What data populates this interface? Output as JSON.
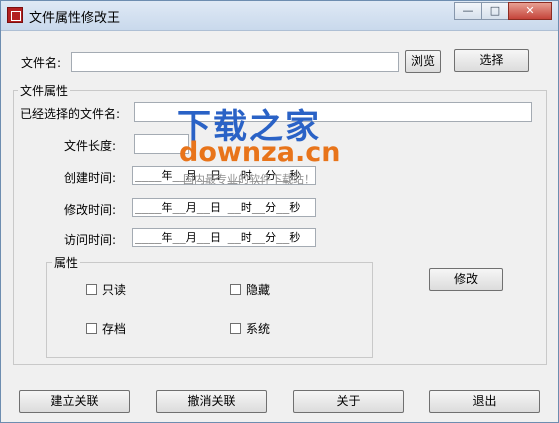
{
  "window": {
    "title": "文件属性修改王",
    "minimize": "—",
    "maximize": "□",
    "close": "✕"
  },
  "file": {
    "label": "文件名:",
    "value": "",
    "browse_label": "浏览",
    "select_label": "选择"
  },
  "attributes_group": {
    "title": "文件属性",
    "selected_name_label": "已经选择的文件名:",
    "selected_name_value": "",
    "length_label": "文件长度:",
    "length_value": "",
    "created_label": "创建时间:",
    "created_value": "____年__月__日 __时__分__秒",
    "modified_label": "修改时间:",
    "modified_value": "____年__月__日 __时__分__秒",
    "accessed_label": "访问时间:",
    "accessed_value": "____年__月__日 __时__分__秒"
  },
  "flags_group": {
    "title": "属性",
    "readonly": "只读",
    "hidden": "隐藏",
    "archive": "存档",
    "system": "系统"
  },
  "modify_label": "修改",
  "bottom_buttons": {
    "associate": "建立关联",
    "unassociate": "撤消关联",
    "about": "关于",
    "exit": "退出"
  },
  "watermark": {
    "cn": "下载之家",
    "en": "downza.cn",
    "sub": "国内最专业的软件下载站！"
  }
}
